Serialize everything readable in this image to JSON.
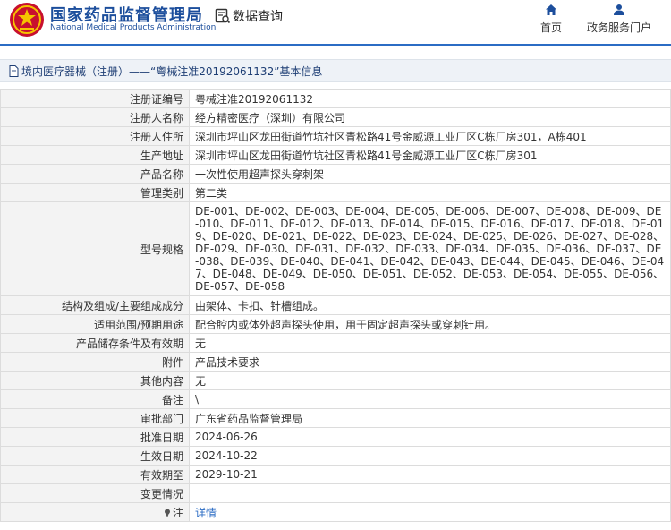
{
  "header": {
    "site_title": "国家药品监督管理局",
    "site_subtitle": "National Medical Products Administration",
    "query_label": "数据查询",
    "nav": [
      {
        "label": "首页",
        "icon": "home-icon"
      },
      {
        "label": "政务服务门户",
        "icon": "user-icon"
      }
    ],
    "brand_color": "#1c4e9c",
    "accent_color": "#2b6cc4"
  },
  "breadcrumb": {
    "text": "境内医疗器械（注册）——“粤械注准20192061132”基本信息"
  },
  "rows": [
    {
      "label": "注册证编号",
      "value": "粤械注准20192061132"
    },
    {
      "label": "注册人名称",
      "value": "经方精密医疗（深圳）有限公司"
    },
    {
      "label": "注册人住所",
      "value": "深圳市坪山区龙田街道竹坑社区青松路41号金威源工业厂区C栋厂房301，A栋401"
    },
    {
      "label": "生产地址",
      "value": "深圳市坪山区龙田街道竹坑社区青松路41号金威源工业厂区C栋厂房301"
    },
    {
      "label": "产品名称",
      "value": "一次性使用超声探头穿刺架"
    },
    {
      "label": "管理类别",
      "value": "第二类"
    },
    {
      "label": "型号规格",
      "value": "DE-001、DE-002、DE-003、DE-004、DE-005、DE-006、DE-007、DE-008、DE-009、DE-010、DE-011、DE-012、DE-013、DE-014、DE-015、DE-016、DE-017、DE-018、DE-019、DE-020、DE-021、DE-022、DE-023、DE-024、DE-025、DE-026、DE-027、DE-028、DE-029、DE-030、DE-031、DE-032、DE-033、DE-034、DE-035、DE-036、DE-037、DE-038、DE-039、DE-040、DE-041、DE-042、DE-043、DE-044、DE-045、DE-046、DE-047、DE-048、DE-049、DE-050、DE-051、DE-052、DE-053、DE-054、DE-055、DE-056、DE-057、DE-058"
    },
    {
      "label": "结构及组成/主要组成成分",
      "value": "由架体、卡扣、针槽组成。"
    },
    {
      "label": "适用范围/预期用途",
      "value": "配合腔内或体外超声探头使用，用于固定超声探头或穿刺针用。"
    },
    {
      "label": "产品储存条件及有效期",
      "value": "无"
    },
    {
      "label": "附件",
      "value": "产品技术要求"
    },
    {
      "label": "其他内容",
      "value": "无"
    },
    {
      "label": "备注",
      "value": "\\"
    },
    {
      "label": "审批部门",
      "value": "广东省药品监督管理局"
    },
    {
      "label": "批准日期",
      "value": "2024-06-26"
    },
    {
      "label": "生效日期",
      "value": "2024-10-22"
    },
    {
      "label": "有效期至",
      "value": "2029-10-21"
    },
    {
      "label": "变更情况",
      "value": ""
    },
    {
      "label": "注",
      "value": "详情"
    }
  ]
}
